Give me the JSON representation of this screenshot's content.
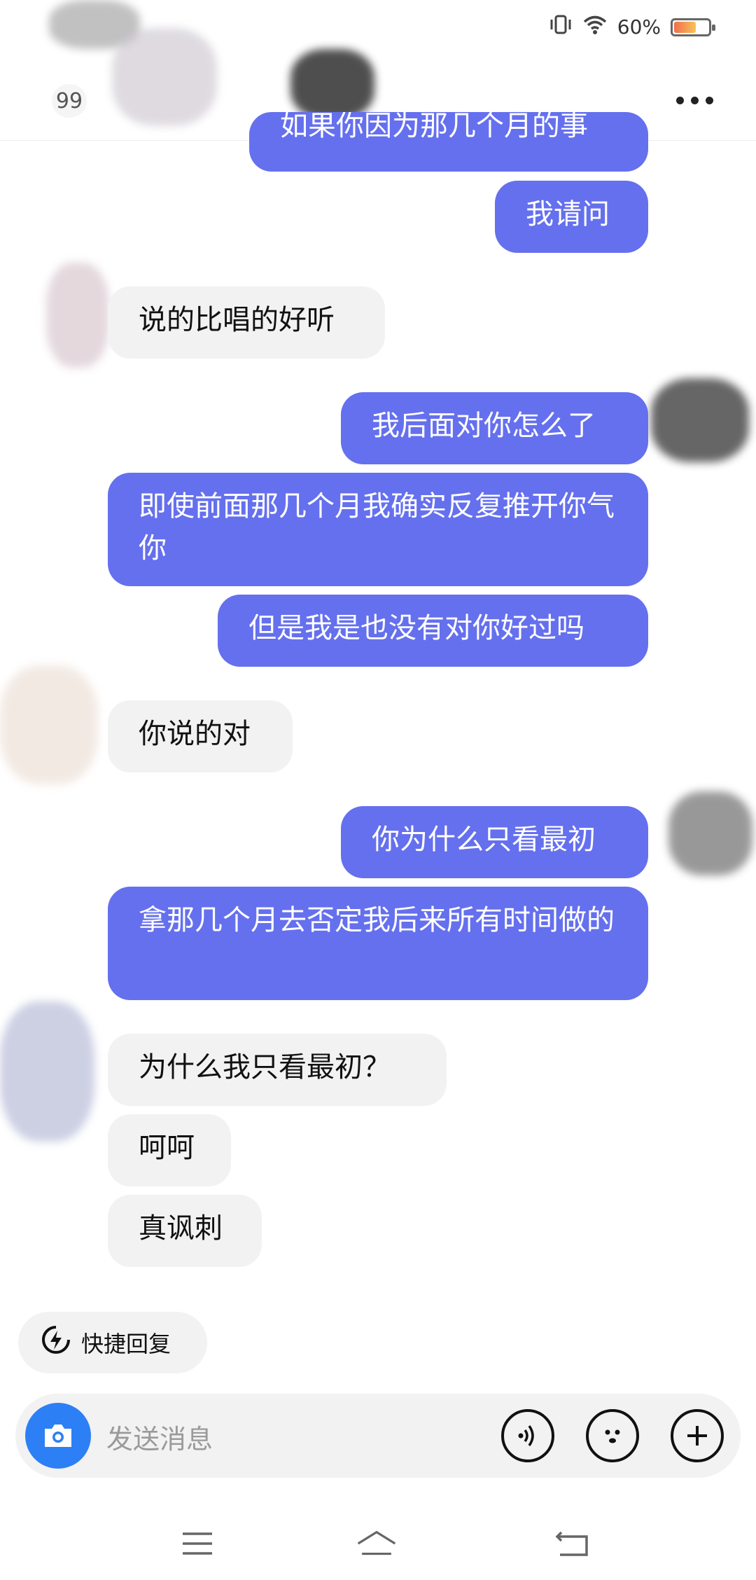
{
  "status_bar": {
    "battery_text": "60%",
    "battery_level": 0.6
  },
  "header": {
    "unread_count": "99"
  },
  "messages": [
    {
      "from": "me",
      "text": "如果你因为那几个月的事"
    },
    {
      "from": "me",
      "text": "我请问"
    },
    {
      "from": "other",
      "text": "说的比唱的好听"
    },
    {
      "from": "me",
      "text": "我后面对你怎么了"
    },
    {
      "from": "me",
      "text": "即使前面那几个月我确实反复推开你气你"
    },
    {
      "from": "me",
      "text": "但是我是也没有对你好过吗"
    },
    {
      "from": "other",
      "text": "你说的对"
    },
    {
      "from": "me",
      "text": "你为什么只看最初"
    },
    {
      "from": "me",
      "text": "拿那几个月去否定我后来所有时间做的"
    },
    {
      "from": "other",
      "text": "为什么我只看最初？"
    },
    {
      "from": "other",
      "text": "呵呵"
    },
    {
      "from": "other",
      "text": "真讽刺"
    }
  ],
  "quick_reply": {
    "label": "快捷回复"
  },
  "input": {
    "placeholder": "发送消息"
  },
  "colors": {
    "my_bubble": "#6570ee",
    "other_bubble": "#f2f2f2",
    "camera_button": "#2d7ff5"
  },
  "icons": [
    "vibrate-icon",
    "wifi-icon",
    "battery-icon",
    "more-icon",
    "lightning-icon",
    "camera-icon",
    "voice-icon",
    "emoji-icon",
    "plus-icon",
    "menu-icon",
    "home-icon",
    "back-icon"
  ]
}
